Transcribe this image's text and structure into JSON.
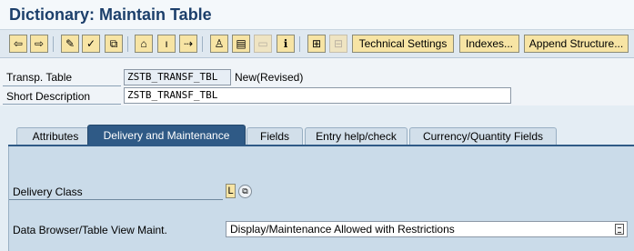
{
  "window": {
    "title": "Dictionary: Maintain Table"
  },
  "toolbar": {
    "technical_settings": "Technical Settings",
    "indexes": "Indexes...",
    "append_structure": "Append Structure..."
  },
  "header": {
    "transp_table_label": "Transp. Table",
    "transp_table_value": "ZSTB_TRANSF_TBL",
    "status": "New(Revised)",
    "short_desc_label": "Short Description",
    "short_desc_value": "ZSTB_TRANSF_TBL"
  },
  "tabs": [
    {
      "label": "Attributes"
    },
    {
      "label": "Delivery and Maintenance",
      "active": true
    },
    {
      "label": "Fields"
    },
    {
      "label": "Entry help/check"
    },
    {
      "label": "Currency/Quantity Fields"
    }
  ],
  "delivery": {
    "delivery_class_label": "Delivery Class",
    "delivery_class_value": "L",
    "data_browser_label": "Data Browser/Table View Maint.",
    "data_browser_value": "Display/Maintenance Allowed with Restrictions"
  },
  "colors": {
    "title": "#1c3f6b",
    "active_tab": "#2f5a86",
    "button_bg": "#f7e4a4",
    "panel_bg": "#cadbe9"
  }
}
